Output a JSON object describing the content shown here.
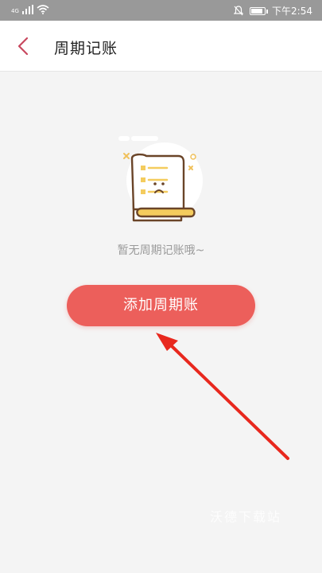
{
  "status_bar": {
    "network": "4G",
    "time": "下午2:54",
    "battery_level": 0.9
  },
  "header": {
    "back_icon": "chevron-left-icon",
    "title": "周期记账"
  },
  "empty_state": {
    "illustration_icon": "sad-document-icon",
    "message": "暂无周期记账哦~"
  },
  "actions": {
    "add_label": "添加周期账"
  },
  "watermark": "沃德下载站",
  "colors": {
    "accent": "#ec5f5b",
    "back_icon": "#c8485f",
    "arrow": "#e8281e",
    "status_bar": "#999999",
    "page_background": "#f4f4f4"
  }
}
